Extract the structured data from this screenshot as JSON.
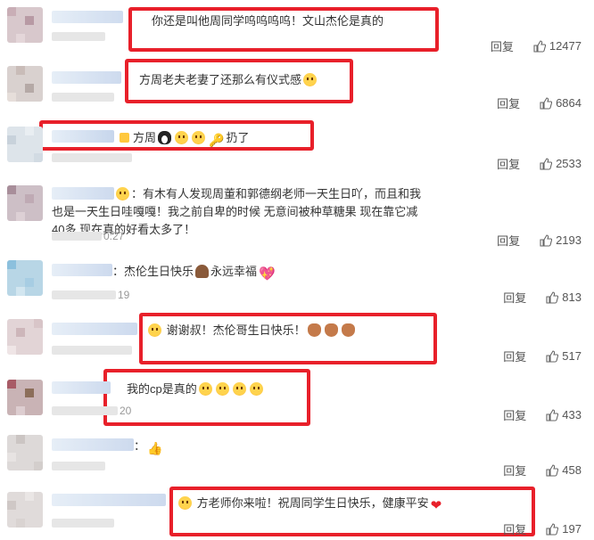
{
  "reply_label": "回复",
  "colors": {
    "highlight": "#e8202a",
    "text": "#333333",
    "muted": "#555555"
  },
  "comments": [
    {
      "text": "你还是叫他周同学呜呜呜呜！文山杰伦是真的",
      "likes": "12477"
    },
    {
      "text": "方周老夫老妻了还那么有仪式感",
      "likes": "6864"
    },
    {
      "text_a": "方周",
      "text_b": "扔了",
      "likes": "2533"
    },
    {
      "text": "：有木有人发现周董和郭德纲老师一天生日吖，而且和我也是一天生日哇嘎嘎！我之前自卑的时候 无意间被种草糖果 现在靠它减40多 现在真的好看太多了！",
      "timestamp": "0:27",
      "likes": "2193"
    },
    {
      "text_a": "：杰伦生日快乐",
      "text_b": "永远幸福",
      "sub": "19",
      "likes": "813"
    },
    {
      "text": "谢谢叔！杰伦哥生日快乐！",
      "likes": "517"
    },
    {
      "text": "我的cp是真的",
      "sub": "20",
      "likes": "433"
    },
    {
      "text": "：",
      "likes": "458"
    },
    {
      "text": "方老师你来啦！祝周同学生日快乐，健康平安",
      "likes": "197"
    }
  ]
}
